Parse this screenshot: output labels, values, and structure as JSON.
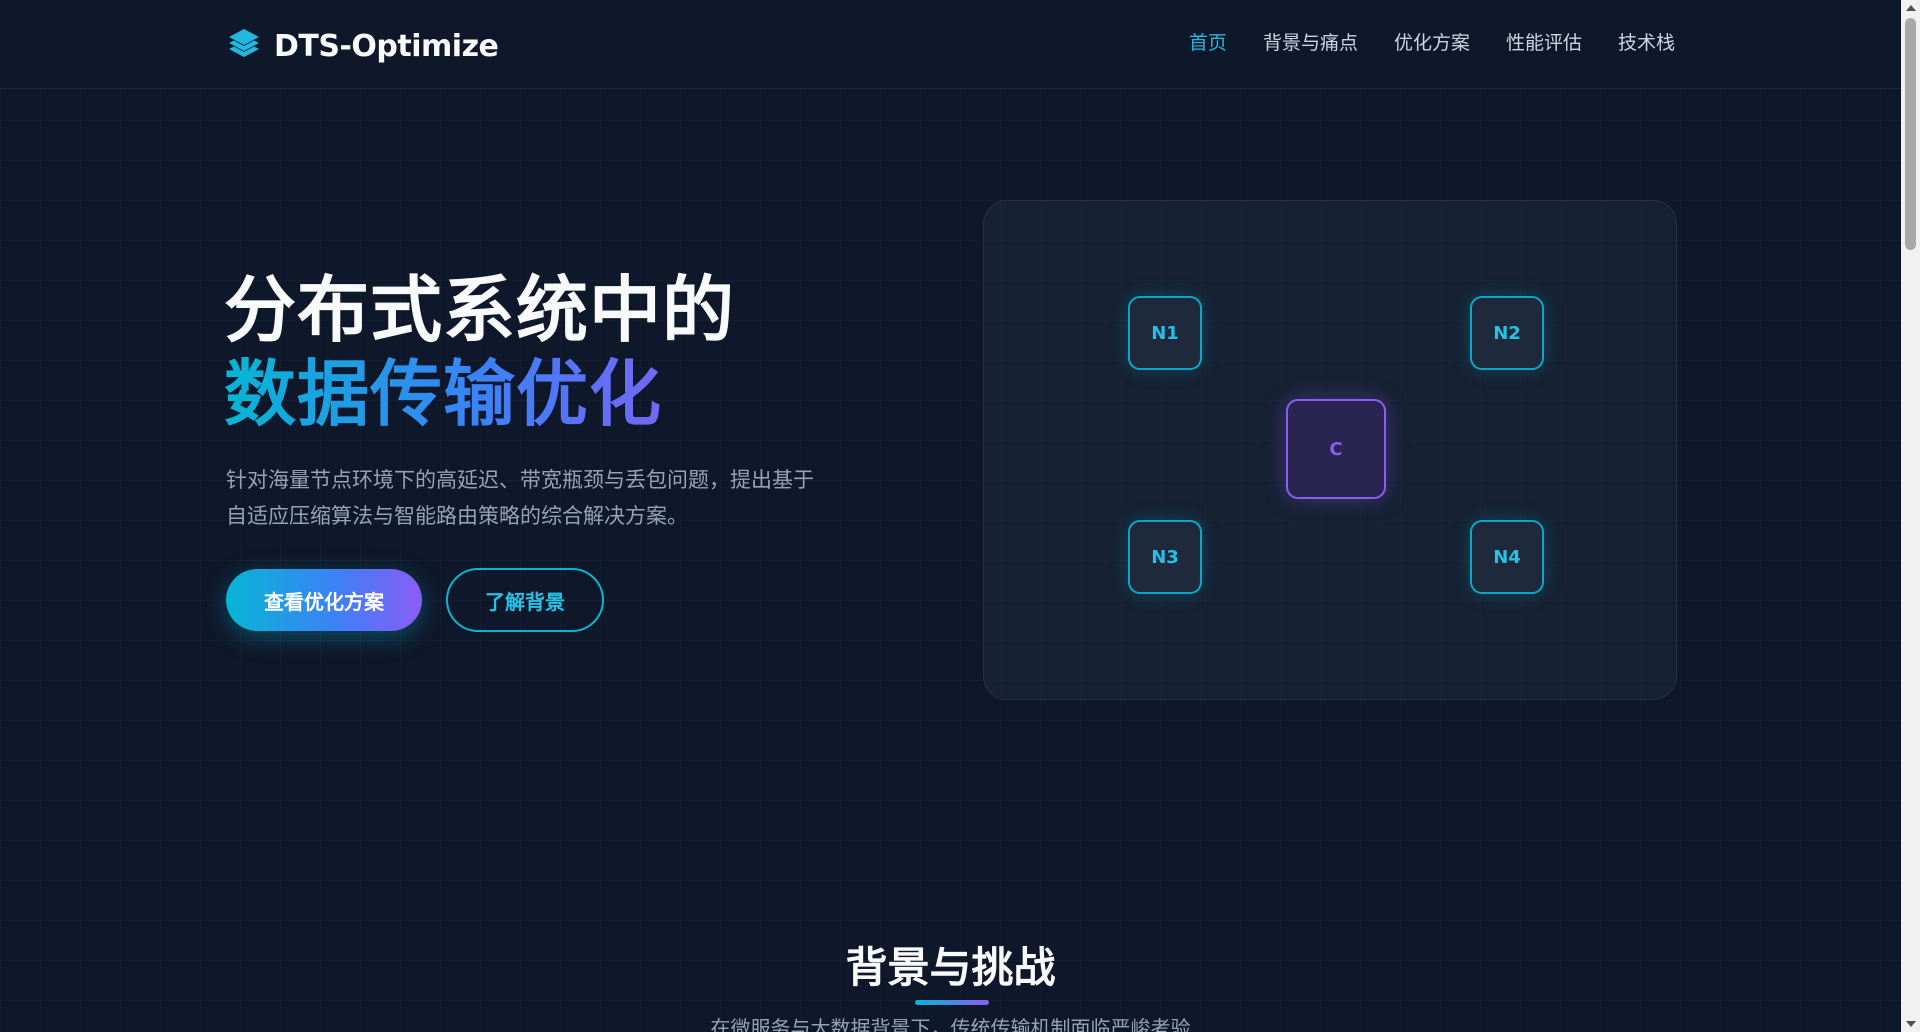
{
  "nav": {
    "logo_text": "DTS-Optimize",
    "logo_icon": "layers-icon",
    "links": [
      {
        "label": "首页",
        "active": true
      },
      {
        "label": "背景与痛点",
        "active": false
      },
      {
        "label": "优化方案",
        "active": false
      },
      {
        "label": "性能评估",
        "active": false
      },
      {
        "label": "技术栈",
        "active": false
      }
    ]
  },
  "hero": {
    "title_line1": "分布式系统中的",
    "title_line2": "数据传输优化",
    "description_line1": "针对海量节点环境下的高延迟、带宽瓶颈与丢包问题，提出基于",
    "description_line2": "自适应压缩算法与智能路由策略的综合解决方案。",
    "primary_button": "查看优化方案",
    "secondary_button": "了解背景"
  },
  "network": {
    "nodes": [
      "N1",
      "N2",
      "N3",
      "N4"
    ],
    "center_node": "C"
  },
  "section": {
    "title": "背景与挑战",
    "subtitle": "在微服务与大数据背景下，传统传输机制面临严峻考验"
  },
  "colors": {
    "background": "#0f172a",
    "accent_cyan": "#06b6d4",
    "accent_purple": "#8b5cf6",
    "accent_blue": "#3b82f6"
  }
}
